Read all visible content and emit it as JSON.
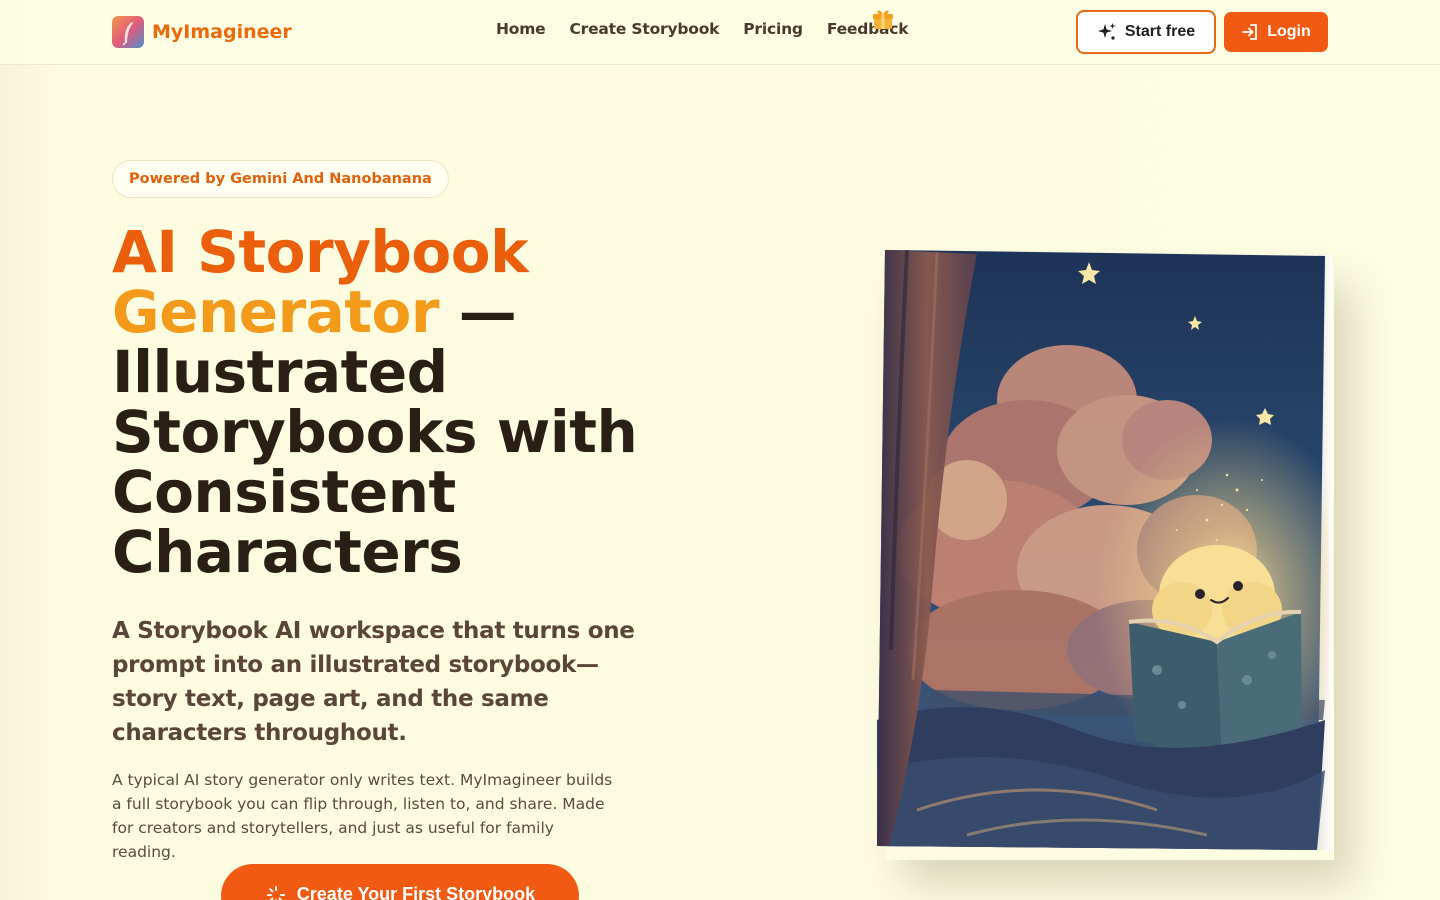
{
  "header": {
    "brand": "MyImagineer",
    "nav": [
      "Home",
      "Create Storybook",
      "Pricing",
      "Feedback"
    ],
    "start_label": "Start free",
    "login_label": "Login"
  },
  "hero": {
    "badge": "Powered by Gemini And Nanobanana",
    "headline": {
      "part1": "AI Storybook",
      "part2": "Generator",
      "part3": " —",
      "part4": "Illustrated Storybooks with Consistent Characters"
    },
    "subhead": "A Storybook AI workspace that turns one prompt into an illustrated storybook—story text, page art, and the same characters throughout.",
    "body": "A typical AI story generator only writes text. MyImagineer builds a full storybook you can flip through, listen to, and share. Made for creators and storytellers, and just as useful for family reading.",
    "cta": "Create Your First Storybook"
  },
  "colors": {
    "accent": "#f15a13",
    "brand": "#ea6a0c",
    "background": "#fdfde3",
    "text": "#2a1f15"
  },
  "icons": {
    "brand": "feather-logo-icon",
    "feedback": "gift-icon",
    "start": "sparkle-icon",
    "login": "login-arrow-icon",
    "cta": "loading-sparkle-icon"
  }
}
